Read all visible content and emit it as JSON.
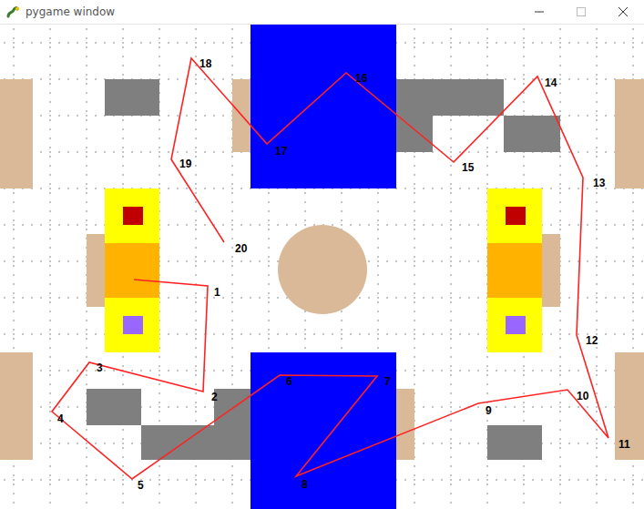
{
  "window": {
    "title": "pygame window"
  },
  "waypoints": [
    {
      "label": "1"
    },
    {
      "label": "2"
    },
    {
      "label": "3"
    },
    {
      "label": "4"
    },
    {
      "label": "5"
    },
    {
      "label": "6"
    },
    {
      "label": "7"
    },
    {
      "label": "8"
    },
    {
      "label": "9"
    },
    {
      "label": "10"
    },
    {
      "label": "11"
    },
    {
      "label": "12"
    },
    {
      "label": "13"
    },
    {
      "label": "14"
    },
    {
      "label": "15"
    },
    {
      "label": "16"
    },
    {
      "label": "17"
    },
    {
      "label": "18"
    },
    {
      "label": "19"
    },
    {
      "label": "20"
    }
  ]
}
